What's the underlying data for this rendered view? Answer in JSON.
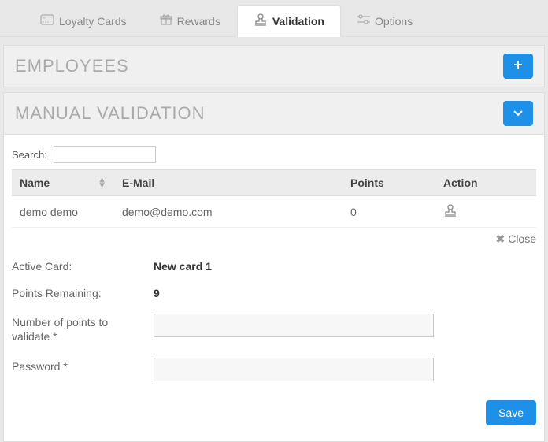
{
  "tabs": {
    "loyalty": "Loyalty Cards",
    "rewards": "Rewards",
    "validation": "Validation",
    "options": "Options"
  },
  "panels": {
    "employees": "EMPLOYEES",
    "manual": "MANUAL VALIDATION"
  },
  "search": {
    "label": "Search:",
    "value": ""
  },
  "table": {
    "headers": {
      "name": "Name",
      "email": "E-Mail",
      "points": "Points",
      "action": "Action"
    },
    "rows": [
      {
        "name": "demo demo",
        "email": "demo@demo.com",
        "points": "0"
      }
    ]
  },
  "close_label": "Close",
  "form": {
    "active_card_label": "Active Card:",
    "active_card_value": "New card 1",
    "points_remaining_label": "Points Remaining:",
    "points_remaining_value": "9",
    "num_points_label": "Number of points to validate *",
    "password_label": "Password *",
    "save_label": "Save"
  }
}
